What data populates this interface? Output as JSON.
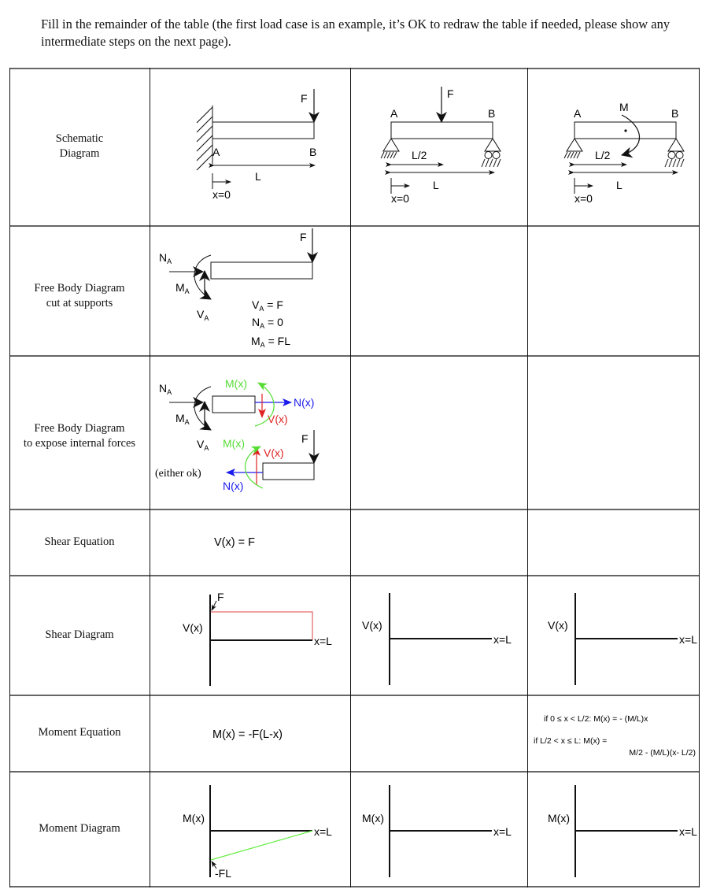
{
  "instructions": "Fill in the remainder of the table (the first load case is an example, it’s OK to redraw the table if needed, please show any intermediate steps on the next page).",
  "row_labels": {
    "schematic": [
      "Schematic",
      "Diagram"
    ],
    "fbd_supports": [
      "Free Body Diagram",
      "cut at supports"
    ],
    "fbd_internal": [
      "Free Body Diagram",
      "to expose internal forces"
    ],
    "shear_eq": "Shear Equation",
    "shear_diag": "Shear Diagram",
    "moment_eq": "Moment Equation",
    "moment_diag": "Moment Diagram"
  },
  "case1": {
    "schematic": {
      "force": "F",
      "pt_a": "A",
      "pt_b": "B",
      "length": "L",
      "origin": "x=0"
    },
    "fbd_supports": {
      "force": "F",
      "n_a": "N",
      "m_a": "M",
      "v_a": "V",
      "sub": "A",
      "results": [
        {
          "sym": "V",
          "sub": "A",
          "val": " = F"
        },
        {
          "sym": "N",
          "sub": "A",
          "val": " = 0"
        },
        {
          "sym": "M",
          "sub": "A",
          "val": " = FL"
        }
      ]
    },
    "fbd_internal": {
      "n_a": "N",
      "m_a": "M",
      "v_a": "V",
      "sub": "A",
      "mx": "M(x)",
      "nx": "N(x)",
      "vx": "V(x)",
      "force": "F",
      "note": "(either ok)"
    },
    "shear_eq": "V(x) = F",
    "shear_diag": {
      "ylabel": "V(x)",
      "xlabel": "x=L",
      "value_label": "F"
    },
    "moment_eq": "M(x) = -F(L-x)",
    "moment_diag": {
      "ylabel": "M(x)",
      "xlabel": "x=L",
      "value_label": "-FL"
    }
  },
  "case2": {
    "schematic": {
      "force": "F",
      "pt_a": "A",
      "pt_b": "B",
      "half": "L/2",
      "length": "L",
      "origin": "x=0"
    },
    "shear_diag": {
      "ylabel": "V(x)",
      "xlabel": "x=L"
    },
    "moment_diag": {
      "ylabel": "M(x)",
      "xlabel": "x=L"
    }
  },
  "case3": {
    "schematic": {
      "moment": "M",
      "pt_a": "A",
      "pt_b": "B",
      "half": "L/2",
      "length": "L",
      "origin": "x=0"
    },
    "shear_diag": {
      "ylabel": "V(x)",
      "xlabel": "x=L"
    },
    "moment_eq": {
      "line1": "if 0 ≤ x < L/2: M(x) = - (M/L)x",
      "line2": "if L/2 < x ≤ L: M(x) =",
      "line3": "M/2 - (M/L)(x- L/2)"
    },
    "moment_diag": {
      "ylabel": "M(x)",
      "xlabel": "x=L"
    }
  },
  "colors": {
    "moment": "#55dd33",
    "normal": "#1a1aee",
    "shear": "#e02222",
    "shear_diag": "#e04040",
    "moment_diag": "#66ee44"
  }
}
